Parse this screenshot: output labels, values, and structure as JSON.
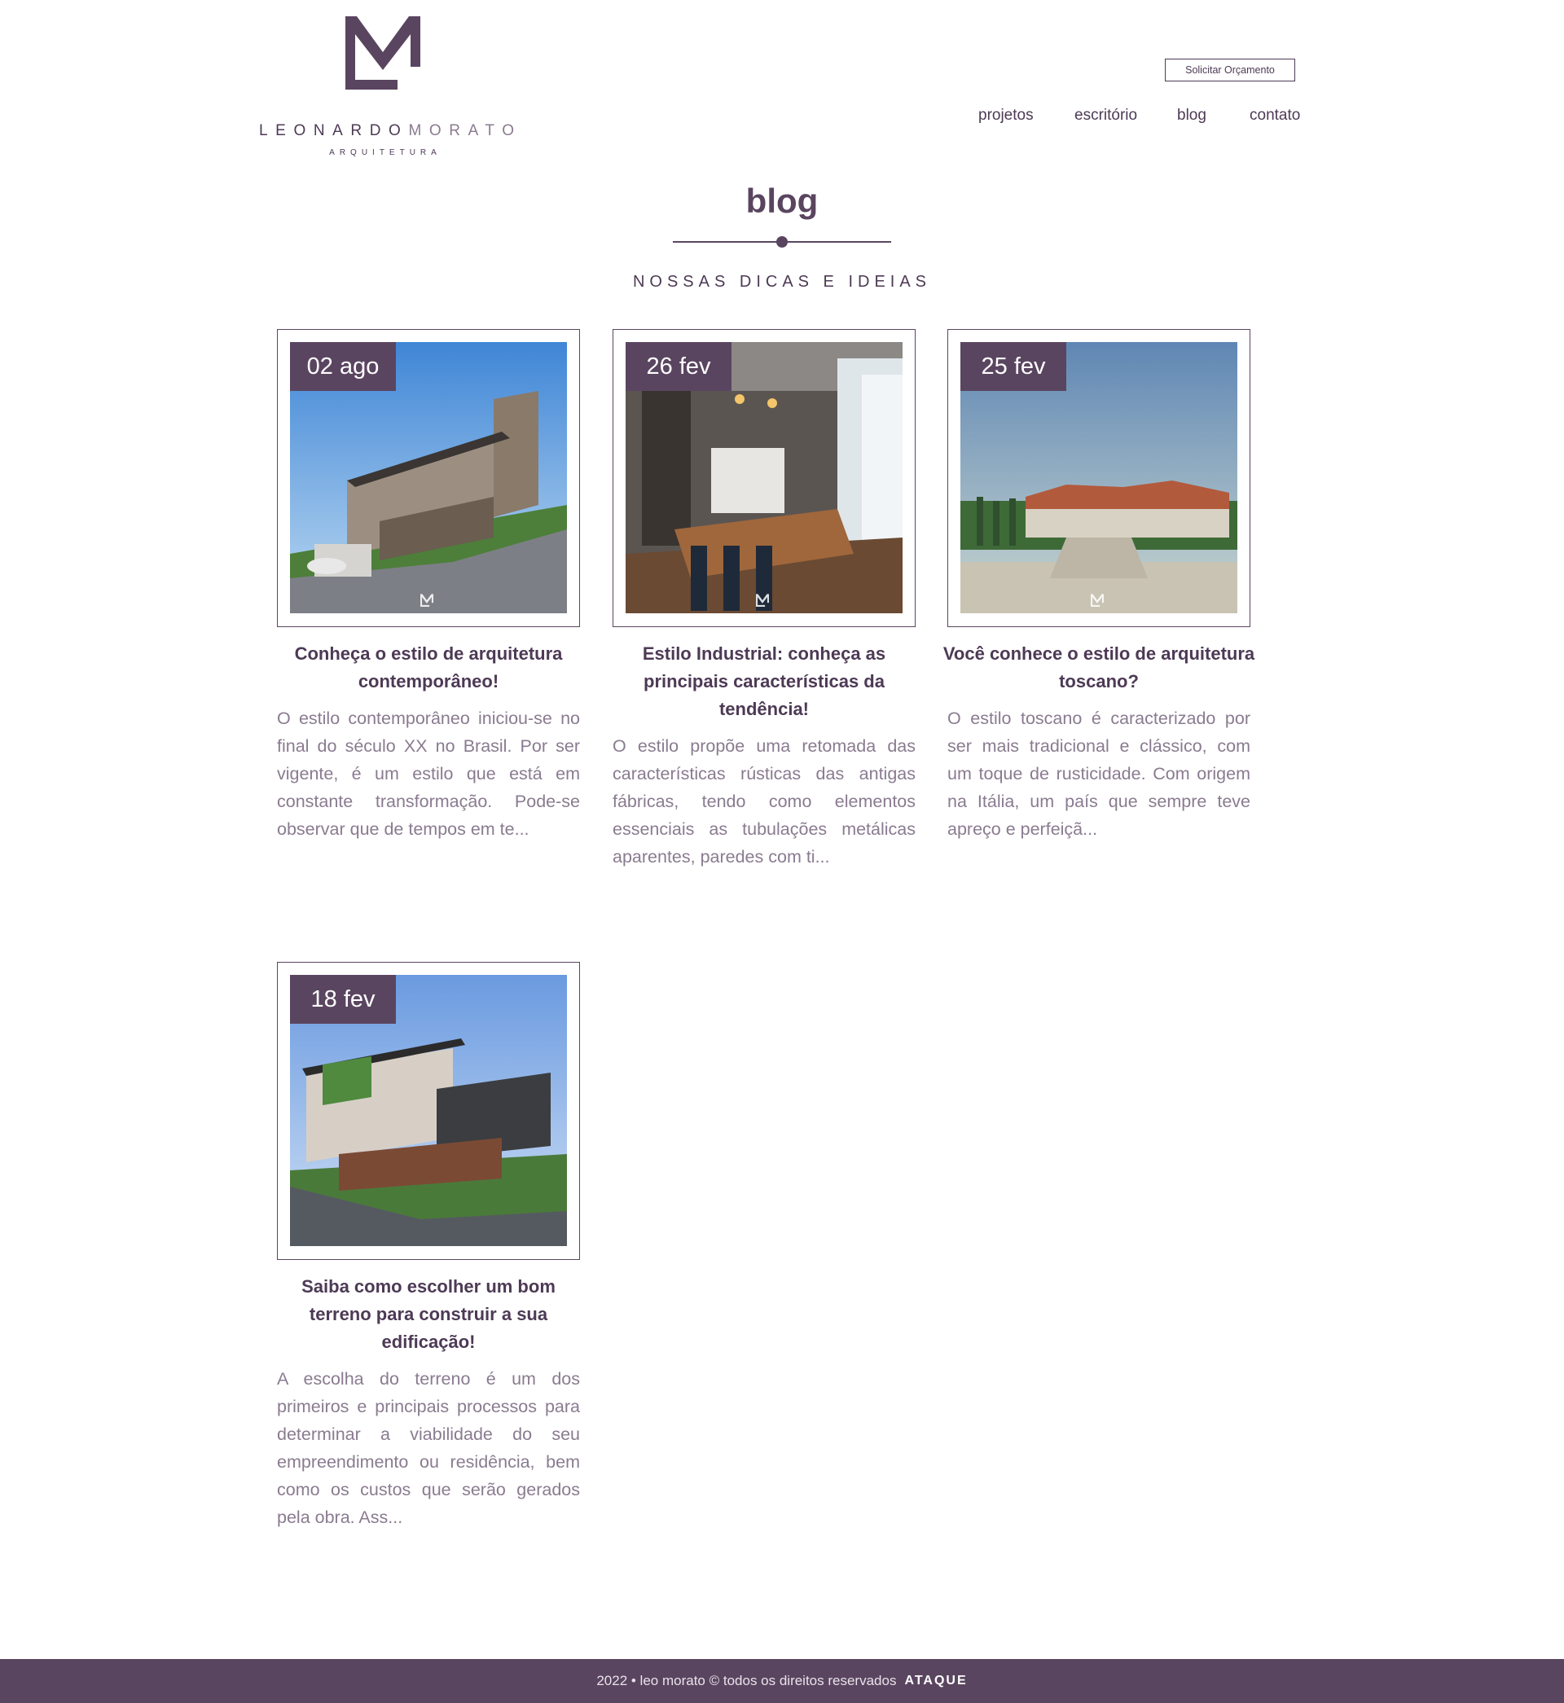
{
  "brand": {
    "name_bold": "LEONARDO",
    "name_light": "MORATO",
    "tagline": "ARQUITETURA",
    "accent_color": "#5a4560"
  },
  "header": {
    "quote_button": "Solicitar Orçamento",
    "nav": [
      "projetos",
      "escritório",
      "blog",
      "contato"
    ]
  },
  "page": {
    "title": "blog",
    "subtitle": "NOSSAS DICAS E IDEIAS"
  },
  "posts": [
    {
      "date": "02 ago",
      "title": "Conheça o estilo de arquitetura contemporâneo!",
      "excerpt": "O estilo contemporâneo iniciou-se no final do século XX no Brasil. Por ser vigente, é um estilo que está em constante transformação. Pode-se observar que de tempos em te..."
    },
    {
      "date": "26 fev",
      "title": "Estilo Industrial: conheça as principais características da tendência!",
      "excerpt": "O estilo propõe uma retomada das características rústicas das antigas fábricas, tendo como elementos essenciais as tubulações metálicas aparentes, paredes com ti..."
    },
    {
      "date": "25 fev",
      "title": "Você conhece o estilo de arquitetura toscano?",
      "excerpt": "O estilo toscano é caracterizado por ser mais tradicional e clássico, com um toque de rusticidade. Com origem na Itália, um país que sempre teve apreço e perfeiçã..."
    },
    {
      "date": "18 fev",
      "title": "Saiba como escolher um bom terreno para construir a sua edificação!",
      "excerpt": "A escolha do terreno é um dos primeiros e principais processos para determinar a viabilidade do seu empreendimento ou residência, bem como os custos que serão gerados pela obra.  Ass..."
    }
  ],
  "footer": {
    "copyright": "2022 • leo morato © todos os direitos reservados",
    "agency": "ATAQUE"
  }
}
